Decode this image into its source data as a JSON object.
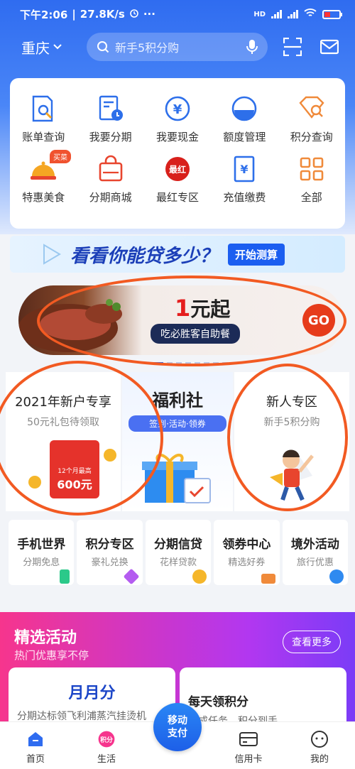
{
  "status_bar": {
    "time": "下午2:06",
    "speed": "27.8K/s",
    "dots": "···",
    "network": "HD",
    "battery": "41"
  },
  "topbar": {
    "city": "重庆",
    "search_placeholder": "新手5积分购"
  },
  "menu": [
    {
      "label": "账单查询",
      "icon": "bill-search-icon"
    },
    {
      "label": "我要分期",
      "icon": "installment-icon"
    },
    {
      "label": "我要现金",
      "icon": "cash-yuan-icon"
    },
    {
      "label": "额度管理",
      "icon": "limit-gauge-icon"
    },
    {
      "label": "积分查询",
      "icon": "points-diamond-icon"
    },
    {
      "label": "特惠美食",
      "icon": "food-cloche-icon",
      "tag": "买菜"
    },
    {
      "label": "分期商城",
      "icon": "shopping-bag-icon"
    },
    {
      "label": "最红专区",
      "icon": "zuihong-icon",
      "badge": "最红"
    },
    {
      "label": "充值缴费",
      "icon": "recharge-icon"
    },
    {
      "label": "全部",
      "icon": "grid-all-icon"
    }
  ],
  "loan_banner": {
    "text": "看看你能贷多少？",
    "button": "开始测算"
  },
  "ad_banner": {
    "title_num": "1",
    "title_rest": "元起",
    "subtitle": "吃必胜客自助餐",
    "go": "GO"
  },
  "promos": {
    "left": {
      "title": "2021年新户专享",
      "subtitle": "50元礼包待领取",
      "hongbao_small": "12个月最高",
      "hongbao_big": "600元"
    },
    "mid": {
      "title": "福利社",
      "subtitle": "签到·活动·领券"
    },
    "right": {
      "title": "新人专区",
      "subtitle": "新手5积分购"
    }
  },
  "quick": [
    {
      "title": "手机世界",
      "sub": "分期免息",
      "color": "#2bc98a"
    },
    {
      "title": "积分专区",
      "sub": "豪礼兑换",
      "color": "#b45cf0"
    },
    {
      "title": "分期信贷",
      "sub": "花样贷款",
      "color": "#f5b62a"
    },
    {
      "title": "领券中心",
      "sub": "精选好券",
      "color": "#f08a3a"
    },
    {
      "title": "境外活动",
      "sub": "旅行优惠",
      "color": "#2f8af0"
    }
  ],
  "activity": {
    "title": "精选活动",
    "subtitle": "热门优惠享不停",
    "more": "查看更多",
    "left": {
      "title": "月月分",
      "desc": "分期达标领飞利浦蒸汽挂烫机"
    },
    "right": {
      "title": "每天领积分",
      "desc": "完成任务，积分到手"
    }
  },
  "nav": {
    "home": "首页",
    "life": "生活",
    "life_badge": "积分",
    "pay": [
      "移动",
      "支付"
    ],
    "card": "信用卡",
    "mine": "我的"
  }
}
